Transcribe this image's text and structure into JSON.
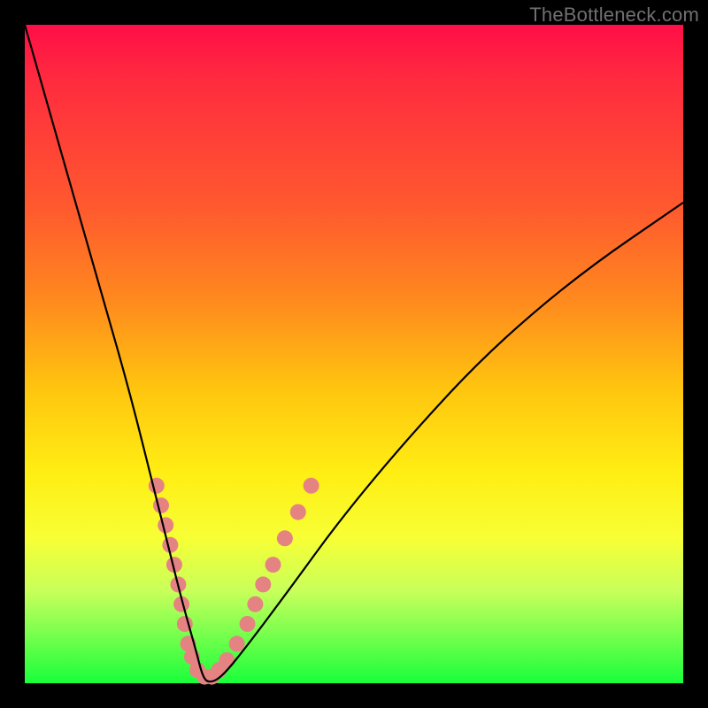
{
  "watermark": "TheBottleneck.com",
  "chart_data": {
    "type": "line",
    "title": "",
    "xlabel": "",
    "ylabel": "",
    "xlim": [
      0,
      100
    ],
    "ylim": [
      0,
      100
    ],
    "grid": false,
    "legend": false,
    "series": [
      {
        "name": "bottleneck-curve",
        "color": "#000000",
        "x_approx": [
          0,
          4,
          8,
          12,
          16,
          20,
          22,
          24,
          26,
          27,
          28,
          30,
          34,
          40,
          48,
          58,
          70,
          84,
          100
        ],
        "y_approx": [
          100,
          86,
          72,
          58,
          44,
          28,
          20,
          12,
          5,
          1,
          0,
          1,
          6,
          14,
          25,
          37,
          50,
          62,
          73
        ]
      }
    ],
    "markers": {
      "name": "highlight-dots",
      "color": "#e58383",
      "radius_px": 9,
      "points_approx": [
        {
          "x": 20.0,
          "y": 30
        },
        {
          "x": 20.7,
          "y": 27
        },
        {
          "x": 21.4,
          "y": 24
        },
        {
          "x": 22.1,
          "y": 21
        },
        {
          "x": 22.7,
          "y": 18
        },
        {
          "x": 23.3,
          "y": 15
        },
        {
          "x": 23.8,
          "y": 12
        },
        {
          "x": 24.3,
          "y": 9
        },
        {
          "x": 24.8,
          "y": 6
        },
        {
          "x": 25.4,
          "y": 4
        },
        {
          "x": 26.2,
          "y": 2
        },
        {
          "x": 27.3,
          "y": 1
        },
        {
          "x": 28.4,
          "y": 1
        },
        {
          "x": 29.5,
          "y": 2
        },
        {
          "x": 30.7,
          "y": 3.5
        },
        {
          "x": 32.2,
          "y": 6
        },
        {
          "x": 33.8,
          "y": 9
        },
        {
          "x": 35.0,
          "y": 12
        },
        {
          "x": 36.2,
          "y": 15
        },
        {
          "x": 37.7,
          "y": 18
        },
        {
          "x": 39.5,
          "y": 22
        },
        {
          "x": 41.5,
          "y": 26
        },
        {
          "x": 43.5,
          "y": 30
        }
      ]
    },
    "background_gradient": {
      "top": "#ff0e47",
      "upper_mid": "#ff8a1e",
      "mid": "#ffee13",
      "lower_mid": "#c8ff5a",
      "bottom": "#19ff3a"
    }
  }
}
